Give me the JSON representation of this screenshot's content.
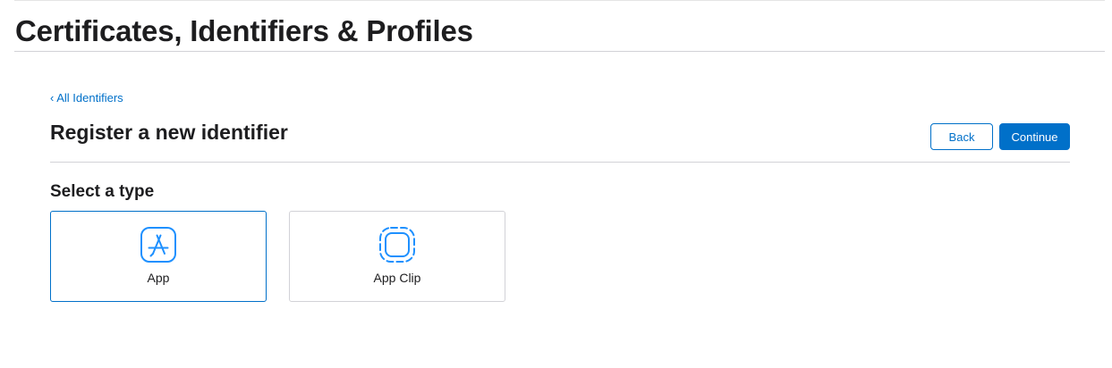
{
  "header": {
    "title": "Certificates, Identifiers & Profiles"
  },
  "nav": {
    "back_link": "‹ All Identifiers"
  },
  "section": {
    "title": "Register a new identifier",
    "back_button": "Back",
    "continue_button": "Continue"
  },
  "type_selector": {
    "label": "Select a type",
    "options": [
      {
        "label": "App",
        "icon": "app-store-icon",
        "selected": true
      },
      {
        "label": "App Clip",
        "icon": "app-clip-icon",
        "selected": false
      }
    ]
  },
  "colors": {
    "accent": "#0070c9",
    "icon_blue": "#1e90ff",
    "border": "#d2d2d7",
    "text": "#1d1d1f"
  }
}
